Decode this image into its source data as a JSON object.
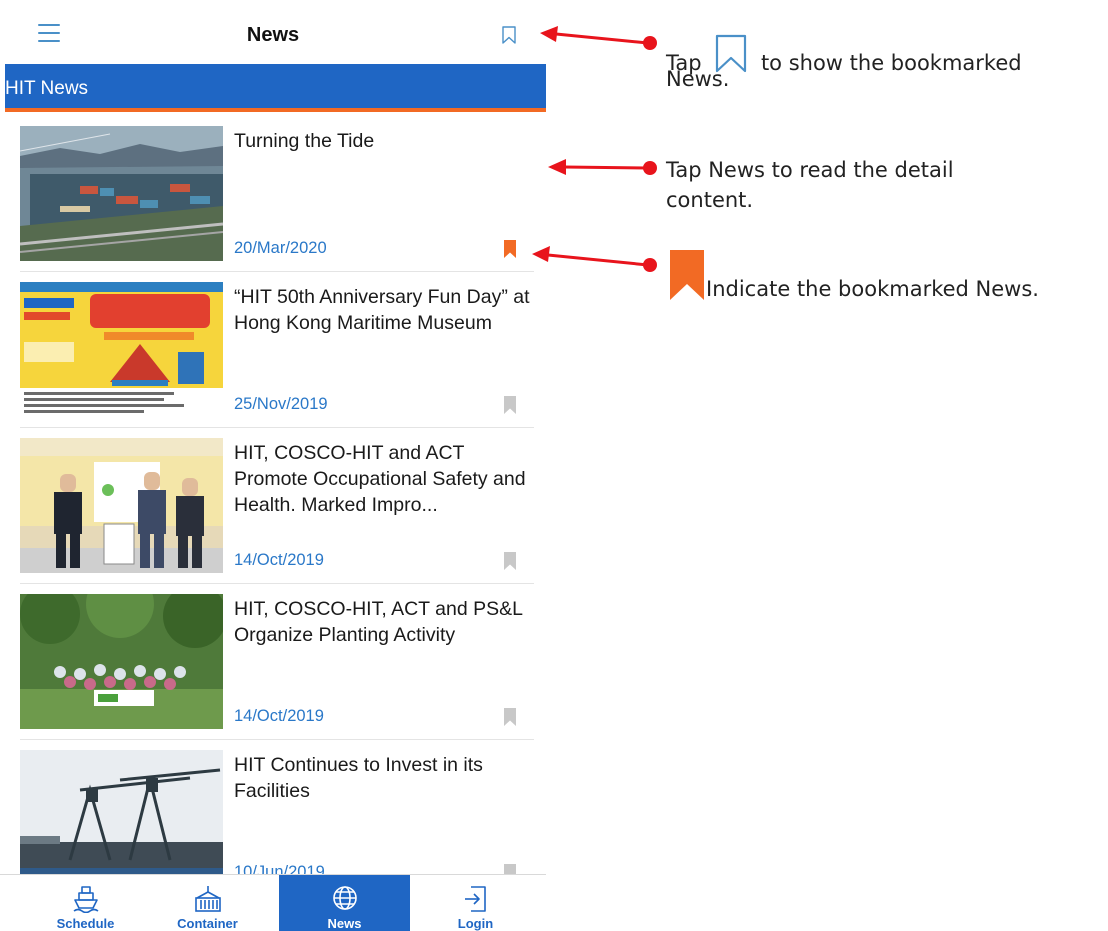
{
  "header": {
    "title": "News",
    "menu_icon": "hamburger-menu-icon",
    "bookmark_icon": "bookmark-outline-icon"
  },
  "section": {
    "title": "HIT News"
  },
  "news": [
    {
      "title": "Turning the Tide",
      "date": "20/Mar/2020",
      "bookmarked": true
    },
    {
      "title": "“HIT 50th Anniversary Fun Day” at Hong Kong Maritime Museum",
      "date": "25/Nov/2019",
      "bookmarked": false
    },
    {
      "title": "HIT, COSCO-HIT and ACT Promote Occupational Safety and Health.    Marked Impro...",
      "date": "14/Oct/2019",
      "bookmarked": false
    },
    {
      "title": "HIT, COSCO-HIT, ACT and PS&L Organize Planting Activity",
      "date": "14/Oct/2019",
      "bookmarked": false
    },
    {
      "title": "HIT Continues to Invest in its Facilities",
      "date": "10/Jun/2019",
      "bookmarked": false
    }
  ],
  "tabs": [
    {
      "label": "Schedule",
      "icon": "ship-icon",
      "active": false
    },
    {
      "label": "Container",
      "icon": "container-icon",
      "active": false
    },
    {
      "label": "News",
      "icon": "globe-icon",
      "active": true
    },
    {
      "label": "Login",
      "icon": "login-icon",
      "active": false
    }
  ],
  "annotations": {
    "bookmark_hint_prefix": "Tap",
    "bookmark_hint_suffix": "to show the bookmarked",
    "bookmark_hint_line2": "News.",
    "read_hint_line1": "Tap News to read the detail",
    "read_hint_line2": "content.",
    "indicator_hint": "Indicate the bookmarked News."
  },
  "colors": {
    "primary_blue": "#1f66c4",
    "accent_orange": "#f26a24",
    "bookmark_gray": "#c8c8c8",
    "arrow_red": "#e8141c",
    "date_blue": "#2a78c8"
  }
}
